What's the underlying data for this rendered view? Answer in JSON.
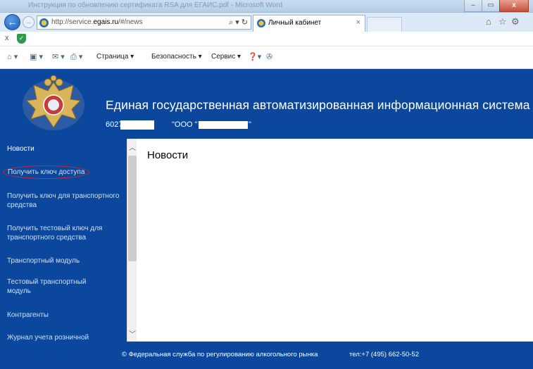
{
  "browser": {
    "window_title": "Инструкция по обновлению сертификата RSA для ЕГАИС.pdf - Microsoft Word",
    "url_prefix": "http://service.",
    "url_domain": "egais.ru",
    "url_suffix": "/#/news",
    "address_tools": "⌕ ▾ ↻",
    "tab_label": "Личный кабинет",
    "tab_close": "×",
    "close_bar": "x",
    "commands": {
      "page": "Страница ▾",
      "security": "Безопасность ▾",
      "service": "Сервис ▾"
    },
    "window_buttons": [
      "–",
      "▭",
      "x"
    ]
  },
  "header": {
    "title": "Единая государственная автоматизированная информационная система",
    "inn": "6027",
    "org": "\"ООО \"",
    "org_suffix": "\""
  },
  "sidebar": {
    "heading": "Новости",
    "items": [
      "Получить ключ доступа",
      "Получить ключ для транспортного средства",
      "Получить тестовый ключ для транспортного средства",
      "Транспортный модуль",
      "Тестовый транспортный модуль",
      "Контрагенты",
      "Журнал учета розничной"
    ]
  },
  "main": {
    "title": "Новости"
  },
  "footer": {
    "copyright": "© Федеральная служба по регулированию алкогольного рынка",
    "phone": "тел:+7 (495) 662-50-52"
  },
  "colors": {
    "brand_blue": "#0b479c",
    "highlight_circle": "#d12a2a"
  }
}
